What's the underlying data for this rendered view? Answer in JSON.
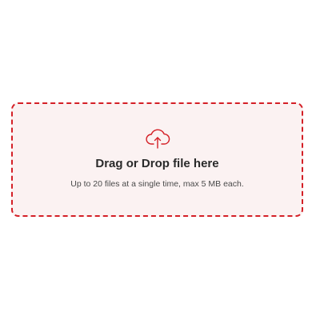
{
  "dropzone": {
    "icon": "cloud-upload-icon",
    "title": "Drag or Drop file here",
    "subtitle": "Up to 20 files at a single time, max 5 MB each."
  },
  "colors": {
    "accent": "#d41f26",
    "background": "#fbf2f2",
    "title_text": "#2a2a2a",
    "subtitle_text": "#4a4a4a"
  }
}
